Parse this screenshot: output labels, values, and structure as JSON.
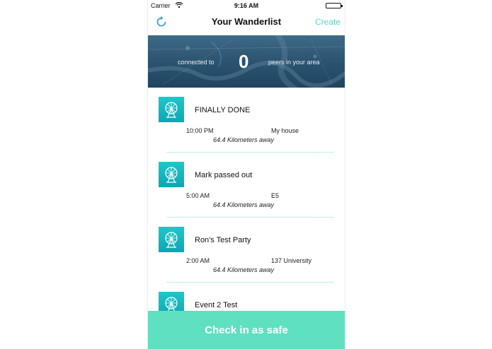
{
  "status_bar": {
    "carrier": "Carrier",
    "time": "9:16 AM"
  },
  "nav": {
    "title": "Your Wanderlist",
    "create_label": "Create",
    "refresh_icon": "refresh-icon"
  },
  "peers": {
    "prefix": "connected to",
    "count": "0",
    "suffix": "peers in your area"
  },
  "events": [
    {
      "name": "FINALLY DONE",
      "time": "10:00 PM",
      "place": "My house",
      "distance": "64.4 Kilometers away"
    },
    {
      "name": "Mark passed out",
      "time": "5:00 AM",
      "place": "E5",
      "distance": "64.4 Kilometers away"
    },
    {
      "name": "Ron's Test Party",
      "time": "2:00 AM",
      "place": "137 University",
      "distance": "64.4 Kilometers away"
    },
    {
      "name": "Event 2 Test",
      "time": "",
      "place": "",
      "distance": ""
    }
  ],
  "event_icon": "ferris-wheel-icon",
  "checkin": {
    "label": "Check in as safe"
  },
  "colors": {
    "accent": "#5fd3c0",
    "checkin_button": "#5fe0c0",
    "thumb": "#12b6c0",
    "banner": "#2d5672"
  }
}
